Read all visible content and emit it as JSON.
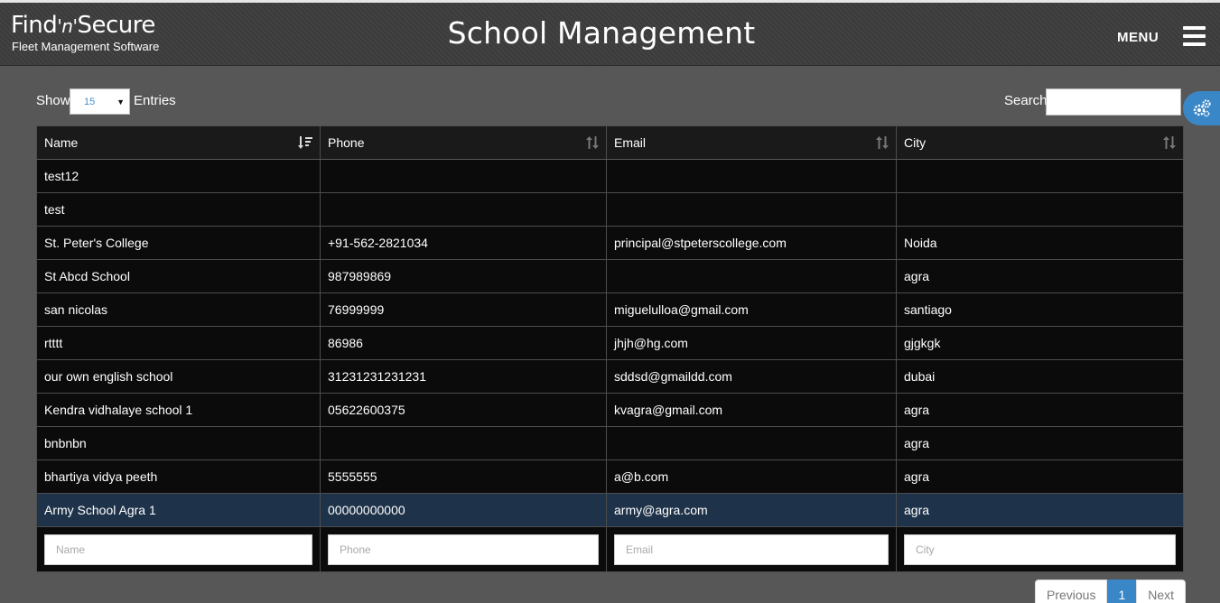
{
  "brand": {
    "name_part1": "Find",
    "name_part2": "'n'",
    "name_part3": "Secure",
    "tagline": "Fleet Management Software"
  },
  "header": {
    "title": "School Management",
    "menu_label": "MENU"
  },
  "controls": {
    "show_label": "Show",
    "entries_value": "15",
    "entries_label": "Entries",
    "search_label": "Search",
    "search_value": ""
  },
  "table": {
    "columns": [
      "Name",
      "Phone",
      "Email",
      "City"
    ],
    "rows": [
      [
        "test12",
        "",
        "",
        ""
      ],
      [
        "test",
        "",
        "",
        ""
      ],
      [
        "St. Peter's College",
        "+91-562-2821034",
        "principal@stpeterscollege.com",
        "Noida"
      ],
      [
        "St Abcd School",
        "987989869",
        "",
        "agra"
      ],
      [
        "san nicolas",
        "76999999",
        "miguelulloa@gmail.com",
        "santiago"
      ],
      [
        "rtttt",
        "86986",
        "jhjh@hg.com",
        "gjgkgk"
      ],
      [
        "our own english school",
        "31231231231231",
        "sddsd@gmaildd.com",
        "dubai"
      ],
      [
        "Kendra vidhalaye school 1",
        "05622600375",
        "kvagra@gmail.com",
        "agra"
      ],
      [
        "bnbnbn",
        "",
        "",
        "agra"
      ],
      [
        "bhartiya vidya peeth",
        "5555555",
        "a@b.com",
        "agra"
      ],
      [
        "Army School Agra 1",
        "00000000000",
        "army@agra.com",
        "agra"
      ]
    ],
    "selected_row": 10,
    "filter_placeholders": [
      "Name",
      "Phone",
      "Email",
      "City"
    ]
  },
  "pagination": {
    "previous": "Previous",
    "current": "1",
    "next": "Next"
  },
  "colors": {
    "accent": "#3a87c8",
    "background": "#575757",
    "table_bg": "#0b0b0b",
    "selected_row": "#1e3249"
  },
  "icons": {
    "settings": "gears-icon",
    "menu": "hamburger-icon",
    "sort": "sort-icon"
  }
}
